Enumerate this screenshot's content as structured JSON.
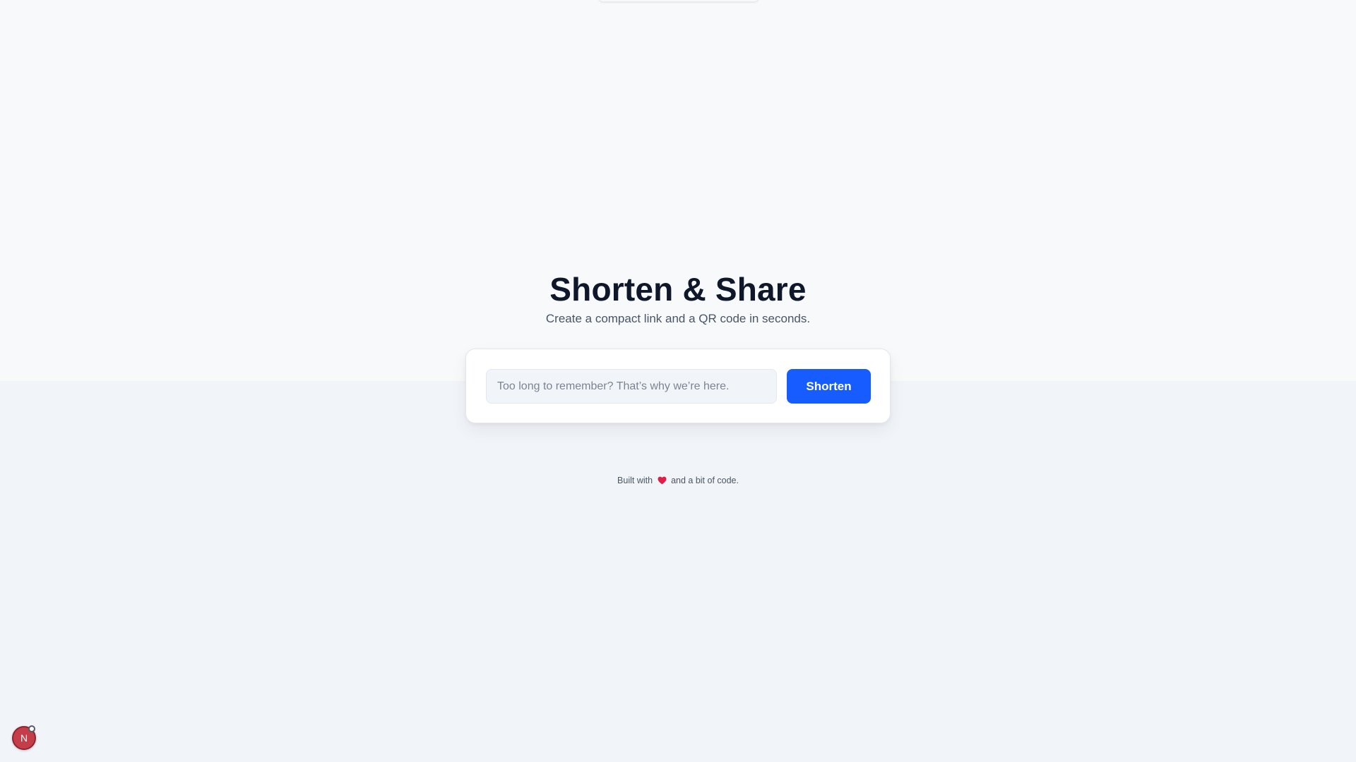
{
  "hero": {
    "title": "Shorten & Share",
    "subtitle": "Create a compact link and a QR code in seconds."
  },
  "form": {
    "url_placeholder": "Too long to remember? That’s why we’re here.",
    "url_value": "",
    "submit_label": "Shorten"
  },
  "footer": {
    "prefix": "Built with",
    "icon": "heart-icon",
    "suffix": "and a bit of code."
  },
  "devtools_badge": {
    "label": "N"
  },
  "colors": {
    "accent": "#165cff",
    "heart": "#e11d48",
    "badge": "#c43d48"
  }
}
